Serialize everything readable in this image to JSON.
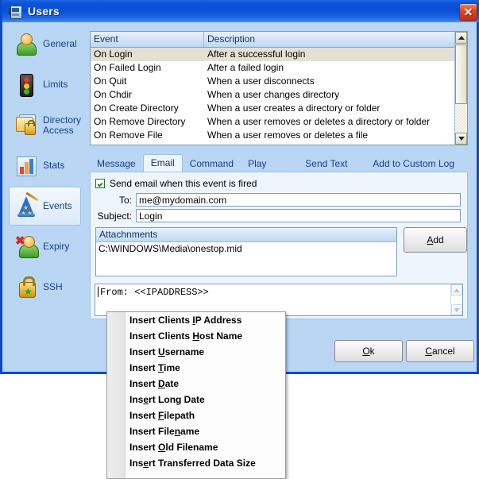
{
  "window": {
    "title": "Users",
    "icon": "users-window-icon",
    "close_label": "✕"
  },
  "sidebar": {
    "items": [
      {
        "label": "General",
        "icon": "user-icon",
        "selected": false
      },
      {
        "label": "Limits",
        "icon": "traffic-light-icon",
        "selected": false
      },
      {
        "label": "Directory\nAccess",
        "icon": "folder-lock-icon",
        "selected": false
      },
      {
        "label": "Stats",
        "icon": "bar-chart-icon",
        "selected": false
      },
      {
        "label": "Events",
        "icon": "wizard-hat-icon",
        "selected": true
      },
      {
        "label": "Expiry",
        "icon": "user-delete-icon",
        "selected": false
      },
      {
        "label": "SSH",
        "icon": "padlock-star-icon",
        "selected": false
      }
    ]
  },
  "event_list": {
    "columns": [
      "Event",
      "Description"
    ],
    "rows": [
      {
        "event": "On Login",
        "description": "After a successful login",
        "selected": true
      },
      {
        "event": "On Failed Login",
        "description": "After a failed login",
        "selected": false
      },
      {
        "event": "On Quit",
        "description": "When a user disconnects",
        "selected": false
      },
      {
        "event": "On Chdir",
        "description": "When a user changes directory",
        "selected": false
      },
      {
        "event": "On Create Directory",
        "description": "When a user creates a directory or folder",
        "selected": false
      },
      {
        "event": "On Remove Directory",
        "description": "When a user removes or deletes a directory or folder",
        "selected": false
      },
      {
        "event": "On Remove File",
        "description": "When a user removes or deletes a file",
        "selected": false
      }
    ]
  },
  "tabs": [
    {
      "label": "Message",
      "selected": false
    },
    {
      "label": "Email",
      "selected": true
    },
    {
      "label": "Command",
      "selected": false
    },
    {
      "label": "Play Sound",
      "selected": false
    },
    {
      "label": "Send Text File",
      "selected": false
    },
    {
      "label": "Add to Custom Log File",
      "selected": false
    }
  ],
  "email_tab": {
    "enable_checkbox": {
      "label": "Send email when this event is fired",
      "checked": true
    },
    "to": {
      "caption": "To:",
      "value": "me@mydomain.com",
      "placeholder": ""
    },
    "subject": {
      "caption": "Subject:",
      "value": "Login",
      "placeholder": ""
    },
    "attachments": {
      "header": "Attachnments",
      "items": [
        "C:\\WINDOWS\\Media\\onestop.mid"
      ],
      "add_label": "Add",
      "add_accel": "A"
    },
    "body": {
      "value": "From: <<IPADDRESS>>"
    }
  },
  "context_menu": {
    "items": [
      {
        "pre": "Insert Clients ",
        "accel": "I",
        "post": "P Address"
      },
      {
        "pre": "Insert Clients ",
        "accel": "H",
        "post": "ost Name"
      },
      {
        "pre": "Insert ",
        "accel": "U",
        "post": "sername"
      },
      {
        "pre": "Insert ",
        "accel": "T",
        "post": "ime"
      },
      {
        "pre": "Insert ",
        "accel": "D",
        "post": "ate"
      },
      {
        "pre": "Ins",
        "accel": "e",
        "post": "rt Long Date"
      },
      {
        "pre": "Insert ",
        "accel": "F",
        "post": "ilepath"
      },
      {
        "pre": "Insert File",
        "accel": "n",
        "post": "ame"
      },
      {
        "pre": "Insert ",
        "accel": "O",
        "post": "ld Filename"
      },
      {
        "pre": "Ins",
        "accel": "e",
        "post": "rt Transferred Data Size"
      }
    ]
  },
  "dialog_buttons": {
    "ok": {
      "pre": "",
      "accel": "O",
      "post": "k"
    },
    "cancel": {
      "pre": "",
      "accel": "C",
      "post": "ancel"
    }
  },
  "colors": {
    "titlebar_blue": "#0a4fd6",
    "dialog_bg": "#b9d6f5",
    "panel_bg": "#eef5fd",
    "selection": "#e4e0d4",
    "close_red": "#c52f10",
    "label_blue": "#1b3f82"
  }
}
